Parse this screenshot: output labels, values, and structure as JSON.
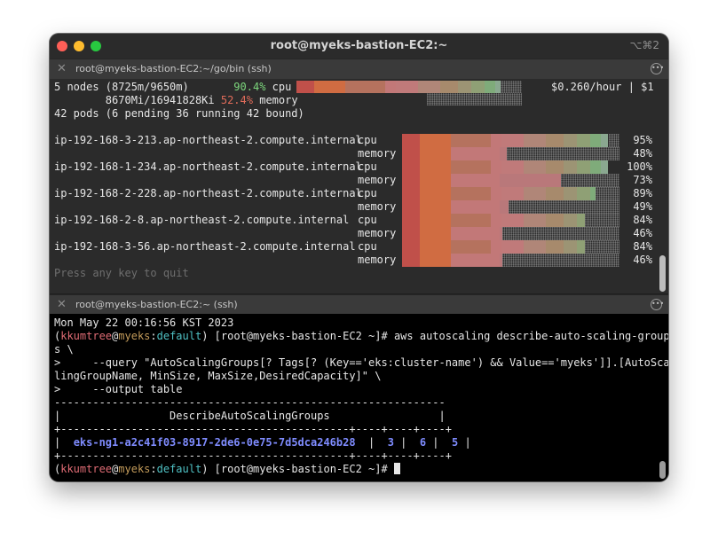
{
  "window": {
    "title": "root@myeks-bastion-EC2:~",
    "shortcut": "⌥⌘2"
  },
  "pane_top": {
    "tab_title": "root@myeks-bastion-EC2:~/go/bin (ssh)",
    "summary": {
      "nodes_prefix": "5 nodes (8725m/9650m)",
      "cpu_pct": "90.4%",
      "cpu_label": "cpu",
      "cost": "$0.260/hour | $1",
      "mem_prefix": "8670Mi/16941828Ki",
      "mem_pct": "52.4%",
      "mem_label": "memory",
      "pods": "42 pods (6 pending 36 running 42 bound)",
      "cpu_level": 0.904,
      "mem_level": 0.524
    },
    "nodes": [
      {
        "name": "ip-192-168-3-213.ap-northeast-2.compute.internal",
        "cpu": "95%",
        "memory": "48%",
        "cpu_level": 0.95,
        "mem_level": 0.48
      },
      {
        "name": "ip-192-168-1-234.ap-northeast-2.compute.internal",
        "cpu": "100%",
        "memory": "73%",
        "cpu_level": 1.0,
        "mem_level": 0.73
      },
      {
        "name": "ip-192-168-2-228.ap-northeast-2.compute.internal",
        "cpu": "89%",
        "memory": "49%",
        "cpu_level": 0.89,
        "mem_level": 0.49
      },
      {
        "name": "ip-192-168-2-8.ap-northeast-2.compute.internal",
        "cpu": "84%",
        "memory": "46%",
        "cpu_level": 0.84,
        "mem_level": 0.46
      },
      {
        "name": "ip-192-168-3-56.ap-northeast-2.compute.internal",
        "cpu": "84%",
        "memory": "46%",
        "cpu_level": 0.84,
        "mem_level": 0.46
      }
    ],
    "labels": {
      "cpu": "cpu",
      "memory": "memory"
    },
    "footer": "Press any key to quit"
  },
  "pane_bottom": {
    "tab_title": "root@myeks-bastion-EC2:~ (ssh)",
    "date_line": "Mon May 22 00:16:56 KST 2023",
    "prompt": {
      "user": "kkumtree",
      "at": "@",
      "host": "myeks",
      "colon": ":",
      "ctx": "default",
      "rest": ") [root@myeks-bastion-EC2 ~]# "
    },
    "command_1": "aws autoscaling describe-auto-scaling-group",
    "cmd_line_2": "s \\",
    "cmd_line_3": ">     --query \"AutoScalingGroups[? Tags[? (Key=='eks:cluster-name') && Value=='myeks']].[AutoSca",
    "cmd_line_4": "lingGroupName, MinSize, MaxSize,DesiredCapacity]\" \\",
    "cmd_line_5": ">     --output table",
    "table": {
      "border_dash": "-------------------------------------------------------------",
      "title_row": "|                 DescribeAutoScalingGroups                 |",
      "border_plus": "+---------------------------------------------+----+----+----+",
      "row": {
        "name": "eks-ng1-a2c41f03-8917-2de6-0e75-7d5dca246b28",
        "min": "3",
        "max": "6",
        "desired": "5"
      }
    }
  }
}
